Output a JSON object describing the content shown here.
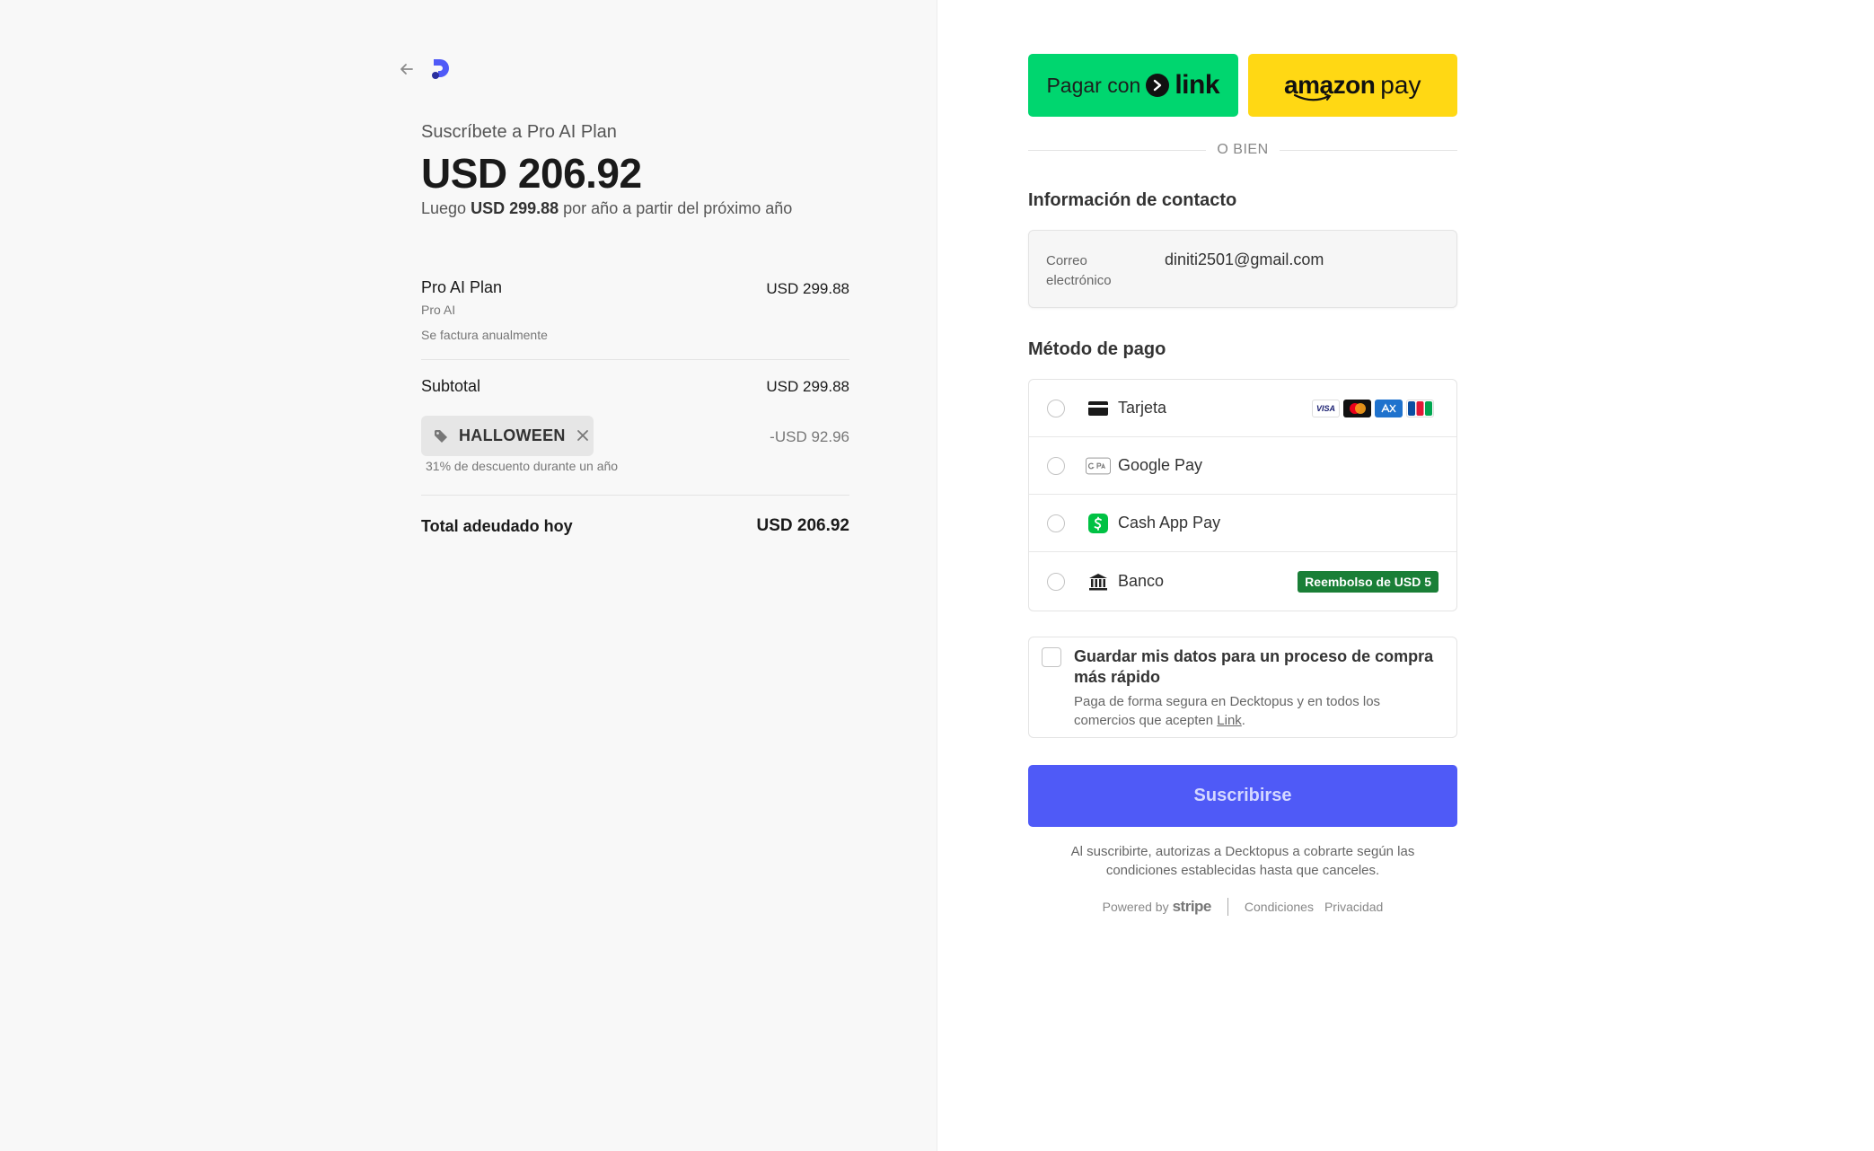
{
  "summary": {
    "subscribe_to": "Suscríbete a Pro AI Plan",
    "amount": "USD 206.92",
    "then_prefix": "Luego",
    "then_amount": "USD 299.88",
    "then_suffix": "por año a partir del próximo año",
    "item_name": "Pro AI Plan",
    "item_price": "USD 299.88",
    "item_sub": "Pro AI",
    "item_billing": "Se factura anualmente",
    "subtotal_label": "Subtotal",
    "subtotal_value": "USD 299.88",
    "promo_code": "HALLOWEEN",
    "discount_value": "-USD 92.96",
    "discount_note": "31% de descuento durante un año",
    "total_label": "Total adeudado hoy",
    "total_value": "USD 206.92"
  },
  "express": {
    "link_label": "Pagar con",
    "link_word": "link",
    "amazon_word": "amazon",
    "amazon_pay": "pay"
  },
  "or_label": "O BIEN",
  "contact": {
    "title": "Información de contacto",
    "email_label": "Correo electrónico",
    "email_value": "diniti2501@gmail.com"
  },
  "payment": {
    "title": "Método de pago",
    "methods": [
      {
        "label": "Tarjeta"
      },
      {
        "label": "Google Pay"
      },
      {
        "label": "Cash App Pay"
      },
      {
        "label": "Banco",
        "badge": "Reembolso de USD 5"
      }
    ],
    "card_brands": [
      "VISA",
      "MC",
      "AMEX",
      "JCB"
    ]
  },
  "save": {
    "title": "Guardar mis datos para un proceso de compra más rápido",
    "desc_prefix": "Paga de forma segura en Decktopus y en todos los comercios que acepten",
    "desc_link": "Link",
    "desc_suffix": "."
  },
  "subscribe_label": "Suscribirse",
  "terms": "Al suscribirte, autorizas a Decktopus a cobrarte según las condiciones establecidas hasta que canceles.",
  "footer": {
    "powered_by": "Powered by",
    "stripe": "stripe",
    "conditions": "Condiciones",
    "privacy": "Privacidad"
  },
  "colors": {
    "link_green": "#00d66f",
    "amazon_yellow": "#ffd814",
    "subscribe_blue": "#4f5af7",
    "refund_green": "#1a7f37"
  }
}
